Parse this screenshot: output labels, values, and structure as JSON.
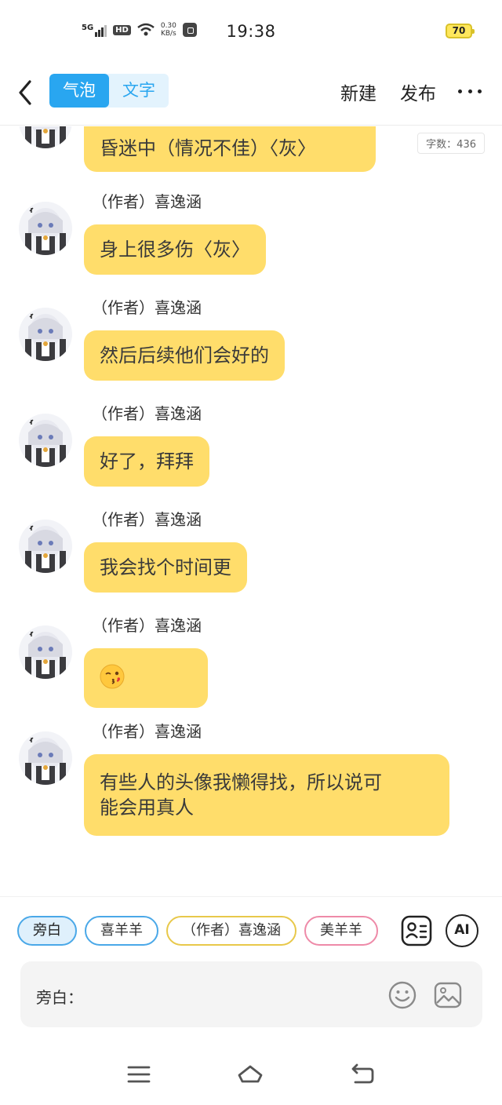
{
  "status_bar": {
    "network": "5G",
    "hd": "HD",
    "speed_value": "0.30",
    "speed_unit": "KB/s",
    "time": "19:38",
    "battery": "70"
  },
  "header": {
    "segment_bubble": "气泡",
    "segment_text": "文字",
    "new_label": "新建",
    "publish_label": "发布"
  },
  "chat": {
    "word_count": "字数：436",
    "messages": [
      {
        "author": "",
        "text": "昏迷中（情况不佳）〈灰〉"
      },
      {
        "author": "（作者）喜逸涵",
        "text": "身上很多伤〈灰〉"
      },
      {
        "author": "（作者）喜逸涵",
        "text": "然后后续他们会好的"
      },
      {
        "author": "（作者）喜逸涵",
        "text": "好了，拜拜"
      },
      {
        "author": "（作者）喜逸涵",
        "text": "我会找个时间更"
      },
      {
        "author": "（作者）喜逸涵",
        "text": "",
        "emoji": "kissing-face-wink"
      },
      {
        "author": "（作者）喜逸涵",
        "text_line1": "有些人的头像我懒得找，所以说可",
        "text_line2": "能会用真人"
      }
    ]
  },
  "panel": {
    "chips": [
      "旁白",
      "喜羊羊",
      "（作者）喜逸涵",
      "美羊羊"
    ],
    "input_label": "旁白：",
    "input_value": "",
    "ai_label": "AI"
  },
  "colors": {
    "bubble": "#ffdd6b",
    "accent": "#29a6f0"
  },
  "icons": [
    "back-icon",
    "more-icon",
    "character-card-icon",
    "ai-icon",
    "emoji-icon",
    "image-icon",
    "menu-icon",
    "home-icon",
    "back-nav-icon"
  ]
}
